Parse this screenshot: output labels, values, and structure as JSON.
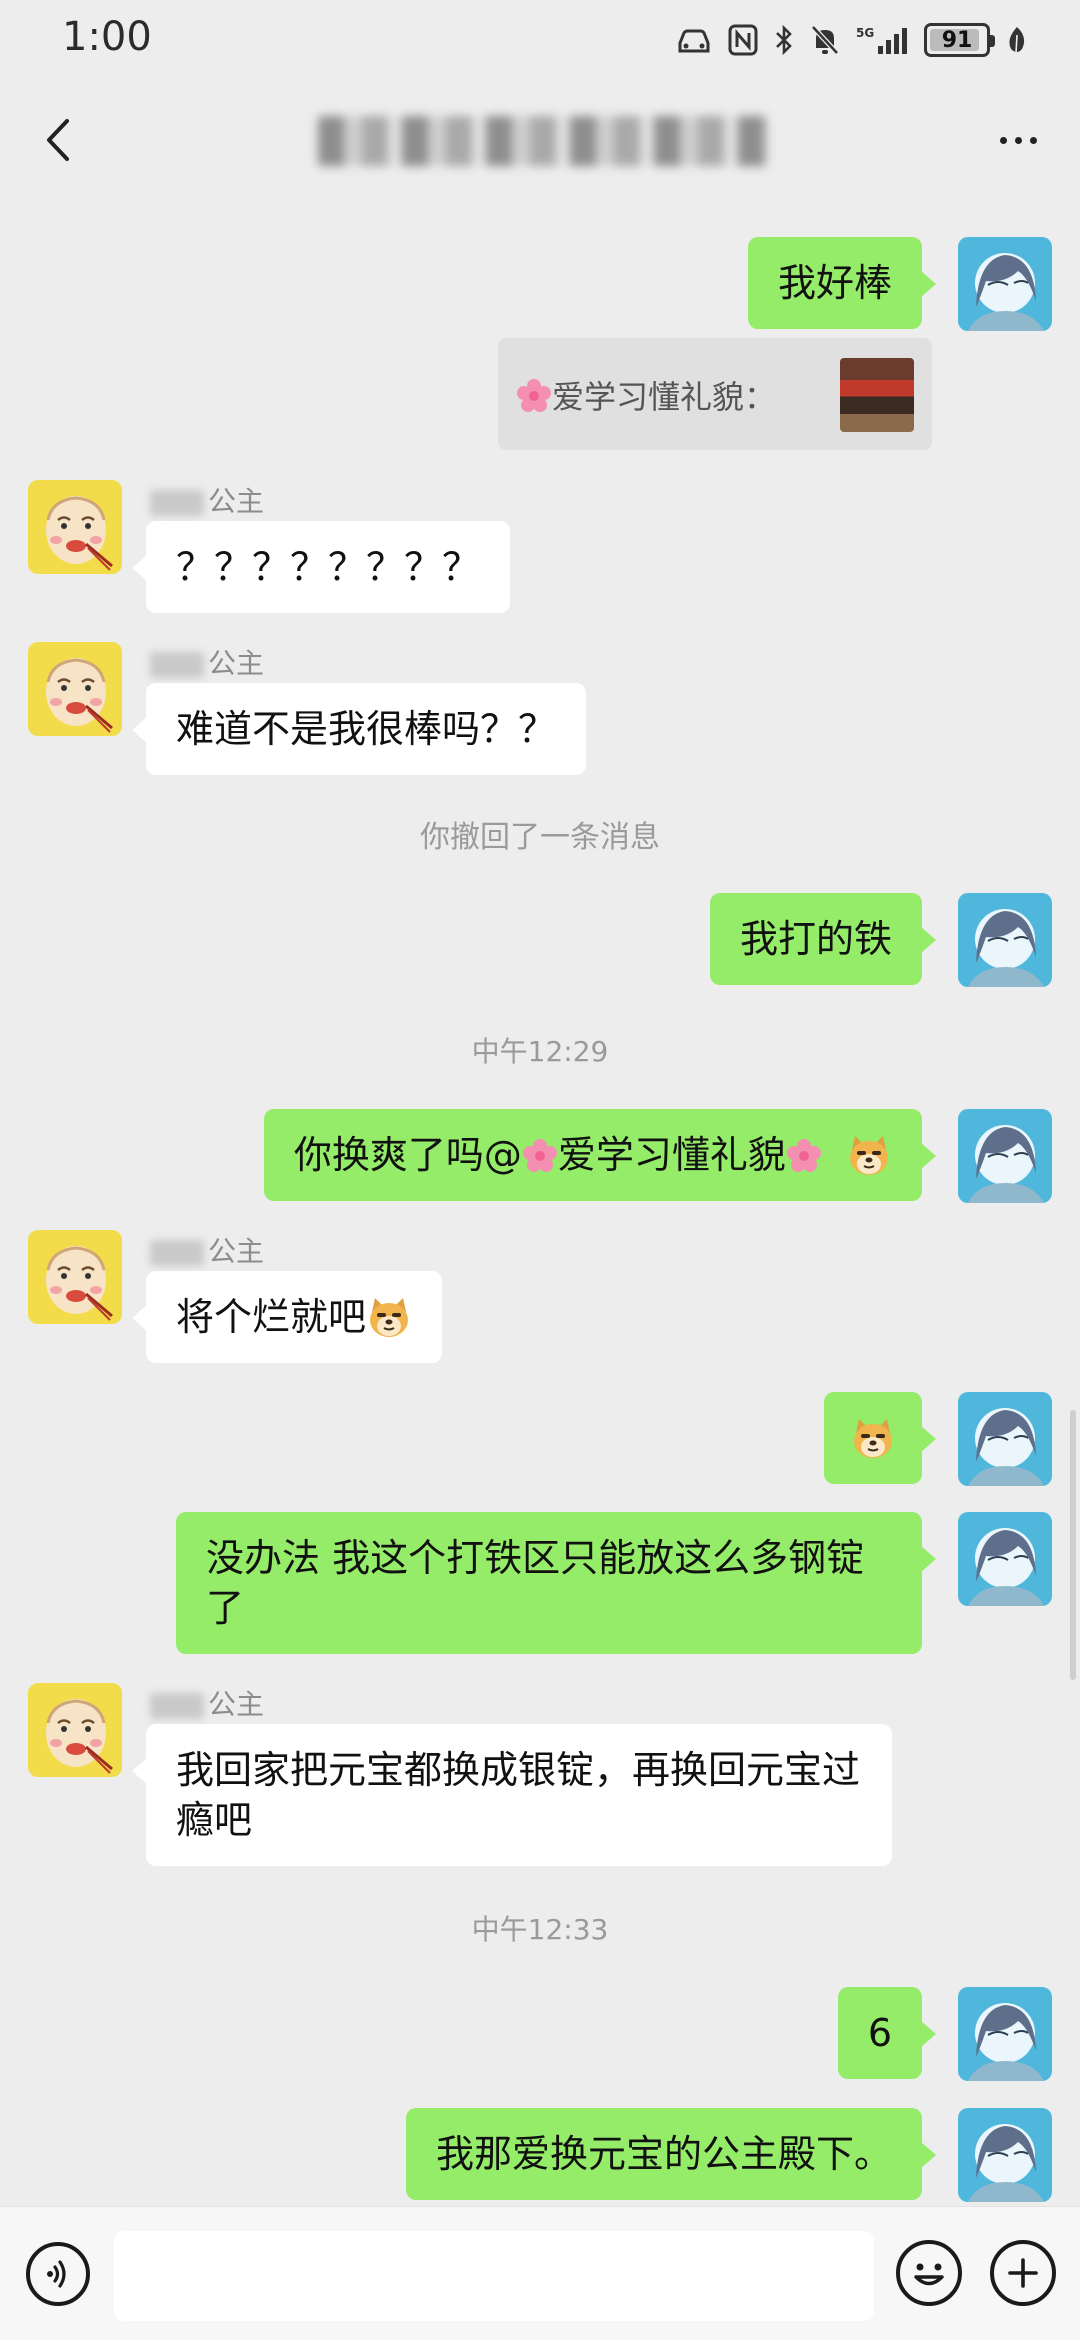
{
  "status_bar": {
    "time": "1:00",
    "battery_percent": 91,
    "battery_label": "91",
    "network_label": "5G",
    "icons": [
      "car-icon",
      "nfc-icon",
      "bluetooth-icon",
      "mute-icon",
      "signal-icon",
      "battery-icon",
      "leaf-icon"
    ]
  },
  "header": {
    "title": "-",
    "back_icon": "chevron-left-icon",
    "more_icon": "more-dots-icon"
  },
  "quote": {
    "text": "爱学习懂礼貌："
  },
  "messages": [
    {
      "side": "me",
      "text": "我好棒"
    },
    {
      "side": "them",
      "sender": "公主",
      "text": "？？？？？？？？"
    },
    {
      "side": "them",
      "sender": "公主",
      "text": "难道不是我很棒吗？？"
    },
    {
      "side": "system",
      "text": "你撤回了一条消息"
    },
    {
      "side": "me",
      "text": "我打的铁"
    },
    {
      "side": "time",
      "text": "中午12:29"
    },
    {
      "side": "me",
      "text_before": "你换爽了吗@",
      "text_after": "爱学习懂礼貌",
      "emoji": "doge-icon"
    },
    {
      "side": "them",
      "sender": "公主",
      "text": "将个烂就吧",
      "emoji": "doge-icon"
    },
    {
      "side": "me",
      "emoji": "doge-icon"
    },
    {
      "side": "me",
      "text": "没办法 我这个打铁区只能放这么多钢锭了"
    },
    {
      "side": "them",
      "sender": "公主",
      "text": "我回家把元宝都换成银锭，再换回元宝过瘾吧"
    },
    {
      "side": "time",
      "text": "中午12:33"
    },
    {
      "side": "me",
      "text": "6"
    },
    {
      "side": "me",
      "text": "我那爱换元宝的公主殿下。"
    }
  ],
  "input_bar": {
    "voice_icon": "voice-icon",
    "emoji_icon": "emoji-icon",
    "plus_icon": "plus-icon",
    "value": ""
  },
  "colors": {
    "background": "#ededed",
    "my_bubble": "#95ec69",
    "their_bubble": "#ffffff",
    "system_text": "#9a9a9a"
  }
}
